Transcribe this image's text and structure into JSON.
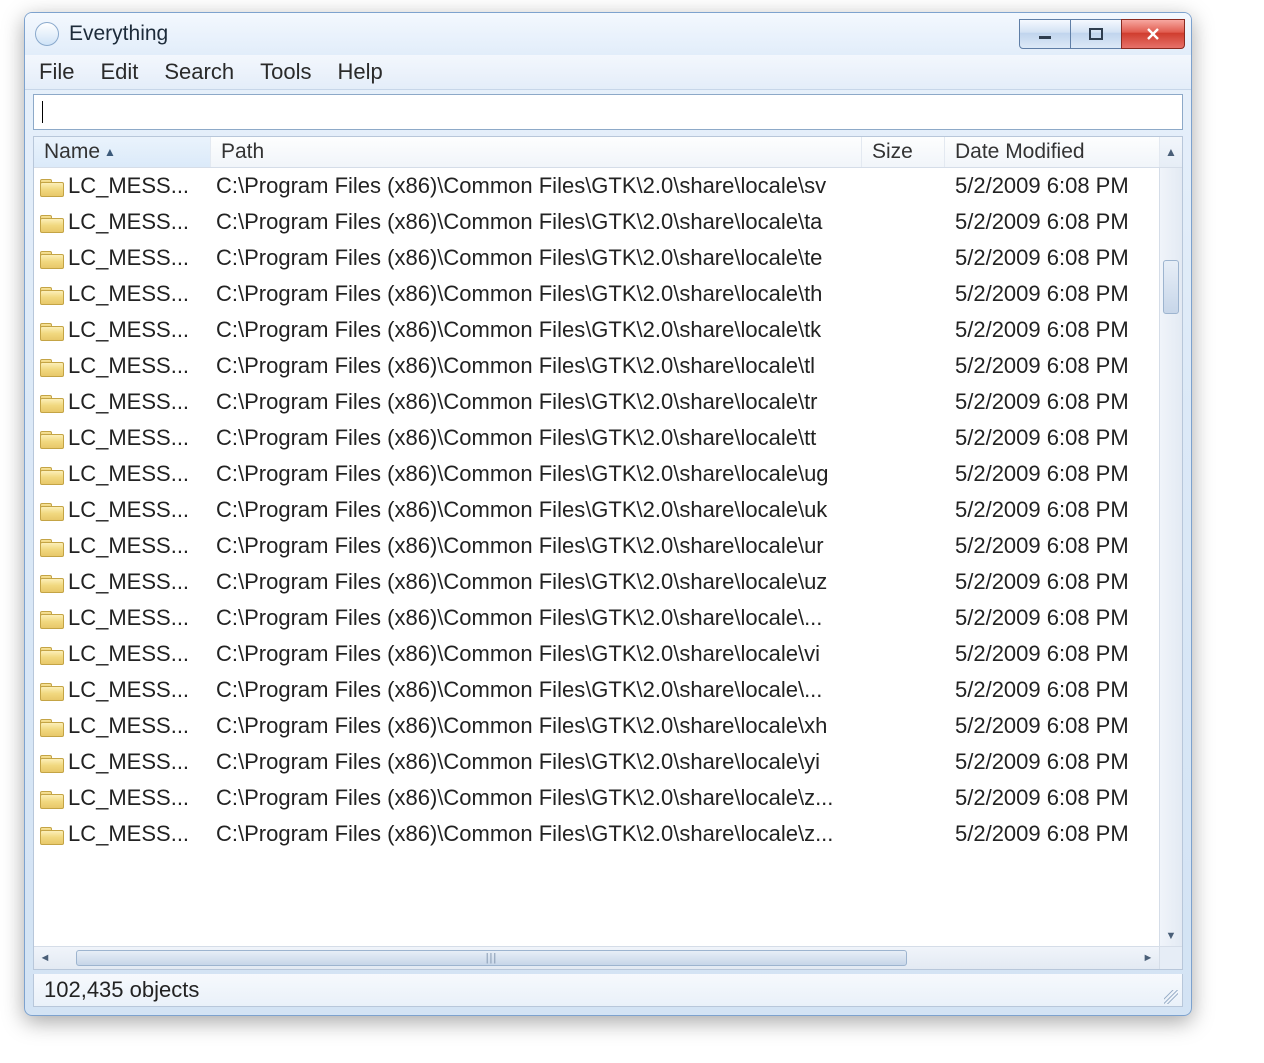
{
  "window": {
    "title": "Everything"
  },
  "menubar": [
    "File",
    "Edit",
    "Search",
    "Tools",
    "Help"
  ],
  "search": {
    "value": ""
  },
  "columns": {
    "name": "Name",
    "path": "Path",
    "size": "Size",
    "date": "Date Modified",
    "sort": "name",
    "sort_dir": "asc"
  },
  "rows": [
    {
      "name": "LC_MESS...",
      "path": "C:\\Program Files (x86)\\Common Files\\GTK\\2.0\\share\\locale\\sv",
      "size": "",
      "date": "5/2/2009 6:08 PM"
    },
    {
      "name": "LC_MESS...",
      "path": "C:\\Program Files (x86)\\Common Files\\GTK\\2.0\\share\\locale\\ta",
      "size": "",
      "date": "5/2/2009 6:08 PM"
    },
    {
      "name": "LC_MESS...",
      "path": "C:\\Program Files (x86)\\Common Files\\GTK\\2.0\\share\\locale\\te",
      "size": "",
      "date": "5/2/2009 6:08 PM"
    },
    {
      "name": "LC_MESS...",
      "path": "C:\\Program Files (x86)\\Common Files\\GTK\\2.0\\share\\locale\\th",
      "size": "",
      "date": "5/2/2009 6:08 PM"
    },
    {
      "name": "LC_MESS...",
      "path": "C:\\Program Files (x86)\\Common Files\\GTK\\2.0\\share\\locale\\tk",
      "size": "",
      "date": "5/2/2009 6:08 PM"
    },
    {
      "name": "LC_MESS...",
      "path": "C:\\Program Files (x86)\\Common Files\\GTK\\2.0\\share\\locale\\tl",
      "size": "",
      "date": "5/2/2009 6:08 PM"
    },
    {
      "name": "LC_MESS...",
      "path": "C:\\Program Files (x86)\\Common Files\\GTK\\2.0\\share\\locale\\tr",
      "size": "",
      "date": "5/2/2009 6:08 PM"
    },
    {
      "name": "LC_MESS...",
      "path": "C:\\Program Files (x86)\\Common Files\\GTK\\2.0\\share\\locale\\tt",
      "size": "",
      "date": "5/2/2009 6:08 PM"
    },
    {
      "name": "LC_MESS...",
      "path": "C:\\Program Files (x86)\\Common Files\\GTK\\2.0\\share\\locale\\ug",
      "size": "",
      "date": "5/2/2009 6:08 PM"
    },
    {
      "name": "LC_MESS...",
      "path": "C:\\Program Files (x86)\\Common Files\\GTK\\2.0\\share\\locale\\uk",
      "size": "",
      "date": "5/2/2009 6:08 PM"
    },
    {
      "name": "LC_MESS...",
      "path": "C:\\Program Files (x86)\\Common Files\\GTK\\2.0\\share\\locale\\ur",
      "size": "",
      "date": "5/2/2009 6:08 PM"
    },
    {
      "name": "LC_MESS...",
      "path": "C:\\Program Files (x86)\\Common Files\\GTK\\2.0\\share\\locale\\uz",
      "size": "",
      "date": "5/2/2009 6:08 PM"
    },
    {
      "name": "LC_MESS...",
      "path": "C:\\Program Files (x86)\\Common Files\\GTK\\2.0\\share\\locale\\...",
      "size": "",
      "date": "5/2/2009 6:08 PM"
    },
    {
      "name": "LC_MESS...",
      "path": "C:\\Program Files (x86)\\Common Files\\GTK\\2.0\\share\\locale\\vi",
      "size": "",
      "date": "5/2/2009 6:08 PM"
    },
    {
      "name": "LC_MESS...",
      "path": "C:\\Program Files (x86)\\Common Files\\GTK\\2.0\\share\\locale\\...",
      "size": "",
      "date": "5/2/2009 6:08 PM"
    },
    {
      "name": "LC_MESS...",
      "path": "C:\\Program Files (x86)\\Common Files\\GTK\\2.0\\share\\locale\\xh",
      "size": "",
      "date": "5/2/2009 6:08 PM"
    },
    {
      "name": "LC_MESS...",
      "path": "C:\\Program Files (x86)\\Common Files\\GTK\\2.0\\share\\locale\\yi",
      "size": "",
      "date": "5/2/2009 6:08 PM"
    },
    {
      "name": "LC_MESS...",
      "path": "C:\\Program Files (x86)\\Common Files\\GTK\\2.0\\share\\locale\\z...",
      "size": "",
      "date": "5/2/2009 6:08 PM"
    },
    {
      "name": "LC_MESS...",
      "path": "C:\\Program Files (x86)\\Common Files\\GTK\\2.0\\share\\locale\\z...",
      "size": "",
      "date": "5/2/2009 6:08 PM"
    }
  ],
  "status": {
    "text": "102,435 objects"
  }
}
